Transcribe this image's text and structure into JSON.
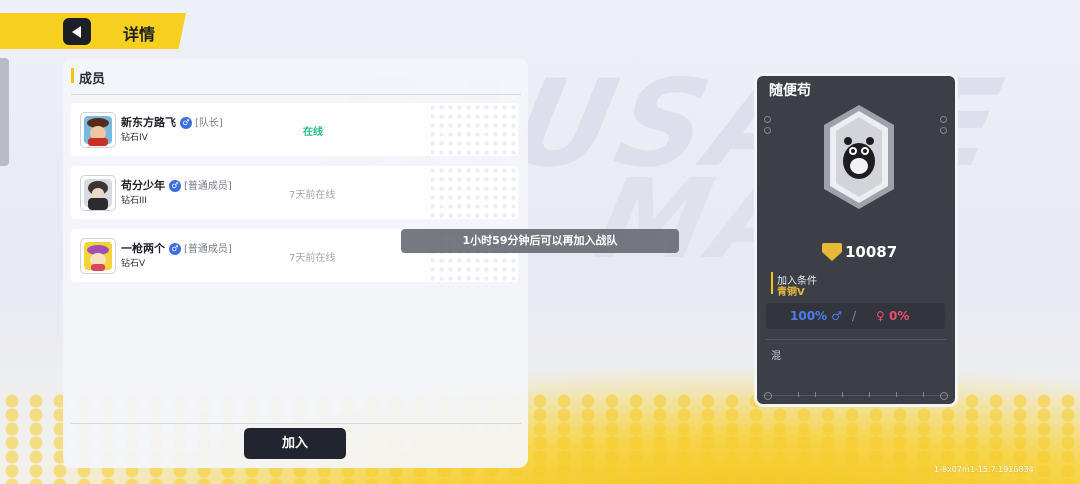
{
  "header": {
    "title": "详情",
    "back_icon": "back-arrow-icon"
  },
  "members_panel": {
    "title": "成员",
    "members": [
      {
        "name": "新东方路飞",
        "gender": "♂",
        "role": "[队长]",
        "rank": "钻石IV",
        "status": "在线",
        "online": true
      },
      {
        "name": "苟分少年",
        "gender": "♂",
        "role": "[普通成员]",
        "rank": "钻石III",
        "status": "7天前在线",
        "online": false
      },
      {
        "name": "一枪两个",
        "gender": "♂",
        "role": "[普通成员]",
        "rank": "钻石V",
        "status": "7天前在线",
        "online": false
      }
    ],
    "join_label": "加入"
  },
  "toast": {
    "text": "1小时59分钟后可以再加入战队"
  },
  "team_card": {
    "name": "随便苟",
    "score": "10087",
    "condition_label": "加入条件",
    "condition_value": "青铜V",
    "male_ratio": "100% ♂",
    "separator": "/",
    "female_ratio": "0%",
    "female_symbol": "♀",
    "description": "混"
  },
  "version": "1-8x07m1-15.7.1916834",
  "colors": {
    "accent": "#f7cf1e",
    "online": "#2bbf8e",
    "male": "#4c7ef0",
    "female": "#e8506b",
    "gold": "#e6b73c"
  }
}
